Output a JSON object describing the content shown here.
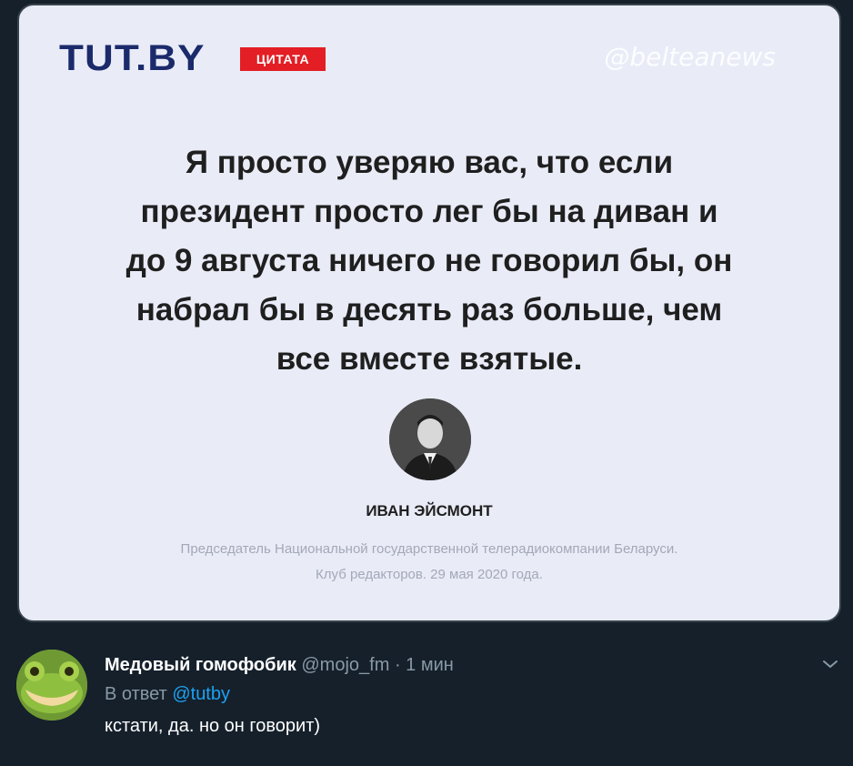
{
  "card": {
    "logo_text": "TUT.BY",
    "badge": "ЦИТАТА",
    "watermark": "@belteanews",
    "quote": "Я просто уверяю вас, что если\nпрезидент просто лег бы на диван и\nдо 9 августа ничего не говорил бы, он\nнабрал бы в десять раз больше, чем\nвсе вместе взятые.",
    "speaker_name": "ИВАН ЭЙСМОНТ",
    "speaker_desc": "Председатель Национальной государственной телерадиокомпании Беларуси.\nКлуб редакторов. 29 мая 2020 года."
  },
  "reply": {
    "display_name": "Медовый гомофобик",
    "handle": "@mojo_fm",
    "separator": "·",
    "time": "1 мин",
    "reply_prefix": "В ответ",
    "reply_mention": "@tutby",
    "text": "кстати, да. но он говорит)"
  },
  "colors": {
    "background": "#15202b",
    "card_bg": "#e9ecf7",
    "logo": "#1b2a6b",
    "badge_red": "#e31e24",
    "link_blue": "#1da1f2",
    "muted": "#8899a6"
  },
  "icons": {
    "chevron": "chevron-down-icon"
  }
}
